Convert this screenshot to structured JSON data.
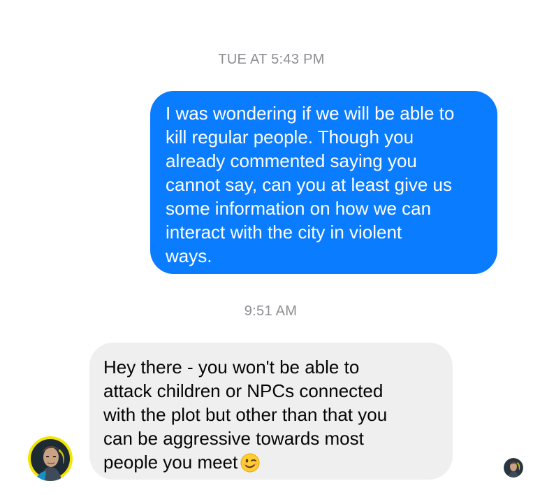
{
  "thread": {
    "timestamp_1": "TUE AT 5:43 PM",
    "timestamp_2": "9:51 AM",
    "sent_message": {
      "lines": [
        "I was wondering if we will be able to",
        "kill regular people. Though you",
        "already commented saying you",
        "cannot say, can you at least give us",
        "some information on how we can",
        "interact with the city in violent",
        "ways."
      ]
    },
    "received_message": {
      "lines": [
        "Hey there - you won't be able to",
        "attack children or NPCs connected",
        "with the plot but other than that you",
        "can be aggressive towards most",
        "people you meet"
      ],
      "emoji_icon": "winking-face-icon"
    }
  },
  "colors": {
    "sent_bubble": "#0a7cff",
    "received_bubble": "#efeff0",
    "timestamp": "#8e8e93",
    "avatar_ring": "#f2e500"
  },
  "icons": [
    "sender-avatar",
    "read-receipt-avatar",
    "winking-face-icon"
  ]
}
